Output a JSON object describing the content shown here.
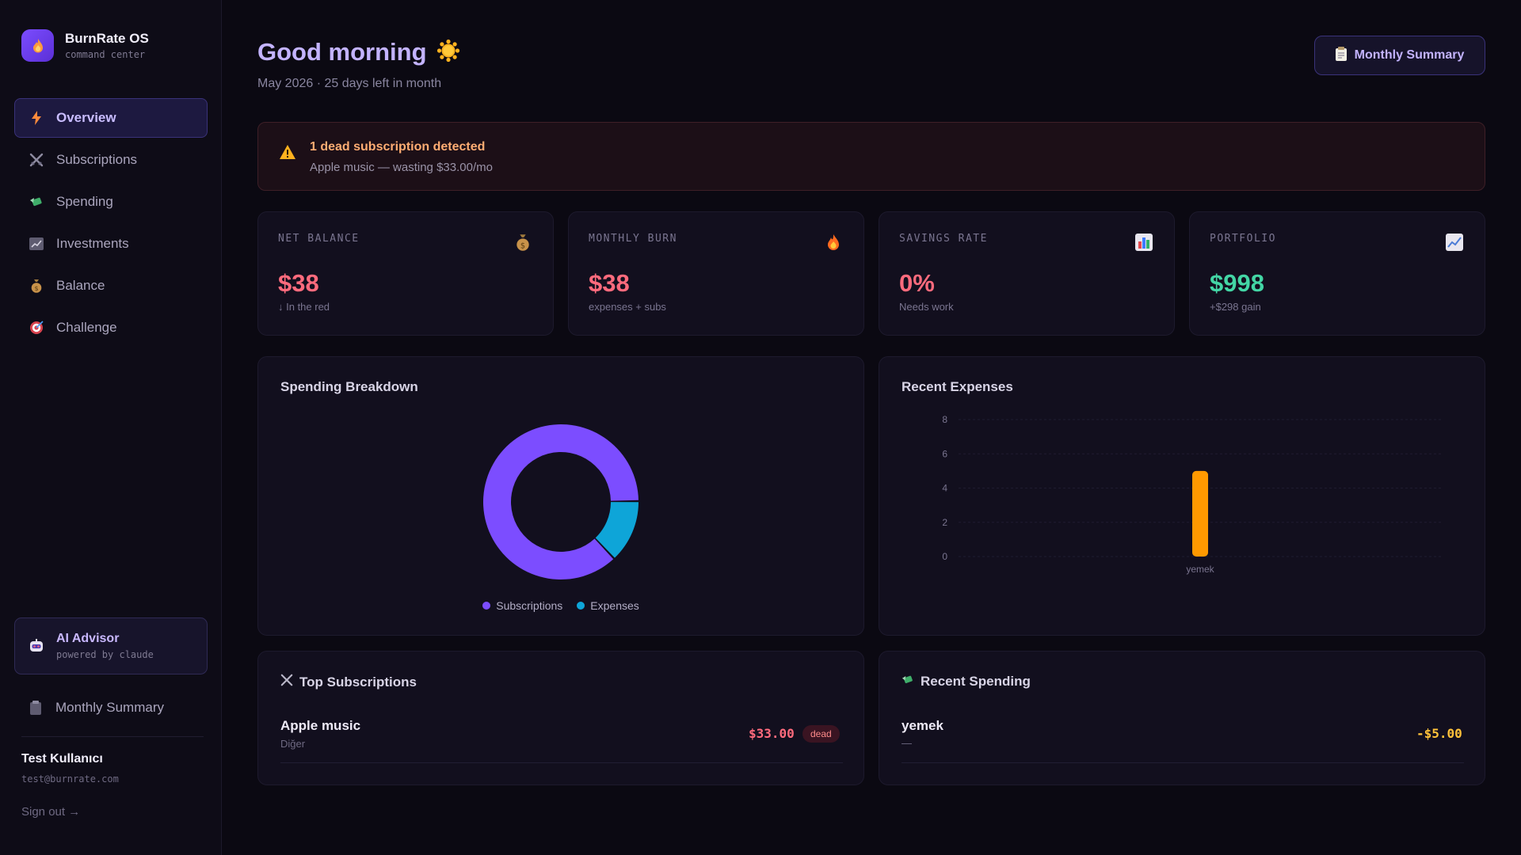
{
  "app": {
    "name": "BurnRate OS",
    "tagline": "command center"
  },
  "sidebar": {
    "items": [
      {
        "label": "Overview",
        "icon": "lightning-icon"
      },
      {
        "label": "Subscriptions",
        "icon": "crossed-swords-icon"
      },
      {
        "label": "Spending",
        "icon": "money-wings-icon"
      },
      {
        "label": "Investments",
        "icon": "chart-icon"
      },
      {
        "label": "Balance",
        "icon": "money-bag-icon"
      },
      {
        "label": "Challenge",
        "icon": "target-icon"
      }
    ],
    "ai_advisor": {
      "title": "AI Advisor",
      "subtitle": "powered by claude"
    },
    "monthly_summary": "Monthly Summary",
    "user": {
      "name": "Test Kullanıcı",
      "email": "test@burnrate.com"
    },
    "sign_out": "Sign out →"
  },
  "header": {
    "greeting": "Good morning",
    "subtitle": "May 2026 · 25 days left in month",
    "summary_button": "Monthly Summary"
  },
  "alert": {
    "title": "1 dead subscription detected",
    "detail": "Apple music — wasting $33.00/mo"
  },
  "stats": [
    {
      "label": "NET BALANCE",
      "value": "$38",
      "sub": "↓ In the red",
      "icon": "money-bag-icon"
    },
    {
      "label": "MONTHLY BURN",
      "value": "$38",
      "sub": "expenses + subs",
      "icon": "fire-icon"
    },
    {
      "label": "SAVINGS RATE",
      "value": "0%",
      "sub": "Needs work",
      "icon": "bar-chart-icon"
    },
    {
      "label": "PORTFOLIO",
      "value": "$998",
      "sub": "+$298 gain",
      "icon": "trend-up-icon"
    }
  ],
  "spending_breakdown": {
    "title": "Spending Breakdown",
    "legend": [
      "Subscriptions",
      "Expenses"
    ]
  },
  "recent_expenses": {
    "title": "Recent Expenses"
  },
  "top_subscriptions": {
    "title": "Top Subscriptions",
    "items": [
      {
        "name": "Apple music",
        "category": "Diğer",
        "amount": "$33.00",
        "badge": "dead"
      }
    ]
  },
  "recent_spending": {
    "title": "Recent Spending",
    "items": [
      {
        "name": "yemek",
        "note": "—",
        "amount": "-$5.00"
      }
    ]
  },
  "colors": {
    "accent": "#7b4dff",
    "subscriptions": "#7c4dff",
    "expenses": "#0ea5d8",
    "bar": "#ff9900",
    "negative": "#ff6b7d",
    "positive": "#43d6a5"
  },
  "chart_data": [
    {
      "type": "pie",
      "title": "Spending Breakdown",
      "categories": [
        "Subscriptions",
        "Expenses"
      ],
      "values": [
        33,
        5
      ],
      "colors": [
        "#7c4dff",
        "#0ea5d8"
      ],
      "legend": "bottom"
    },
    {
      "type": "bar",
      "title": "Recent Expenses",
      "categories": [
        "yemek"
      ],
      "values": [
        5
      ],
      "ylim": [
        0,
        8
      ],
      "yticks": [
        0,
        2,
        4,
        6,
        8
      ],
      "grid": true,
      "colors": [
        "#ff9900"
      ]
    }
  ]
}
